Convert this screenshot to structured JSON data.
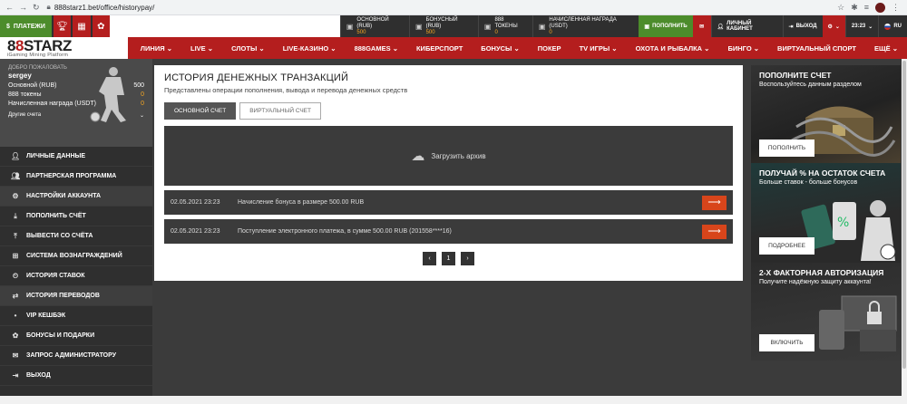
{
  "browser": {
    "url": "888starz1.bet/office/historypay/"
  },
  "topbar": {
    "pay_label": "ПЛАТЕЖИ",
    "accounts": [
      {
        "label": "ОСНОВНОЙ (RUB)",
        "value": "500"
      },
      {
        "label": "БОНУСНЫЙ (RUB)",
        "value": "500"
      },
      {
        "label": "888 ТОКЕНЫ",
        "value": "0"
      },
      {
        "label": "НАЧИСЛЕННАЯ НАГРАДА (USDT)",
        "value": "0"
      }
    ],
    "deposit_label": "ПОПОЛНИТЬ",
    "cabinet_label": "ЛИЧНЫЙ КАБИНЕТ",
    "logout_label": "ВЫХОД",
    "time": "23:23",
    "lang": "RU"
  },
  "logo": {
    "main_prefix": "8",
    "main_mid": "8",
    "main_rest": "STARZ",
    "tagline": "iGaming Mining Platform"
  },
  "menu": [
    "ЛИНИЯ",
    "LIVE",
    "СЛОТЫ",
    "LIVE-КАЗИНО",
    "888GAMES",
    "КИБЕРСПОРТ",
    "БОНУСЫ",
    "ПОКЕР",
    "TV ИГРЫ",
    "ОХОТА И РЫБАЛКА",
    "БИНГО",
    "ВИРТУАЛЬНЫЙ СПОРТ",
    "ЕЩЁ"
  ],
  "profile": {
    "welcome": "ДОБРО ПОЖАЛОВАТЬ",
    "username": "sergey",
    "rows": [
      {
        "label": "Основной (RUB)",
        "value": "500"
      },
      {
        "label": "888 токены",
        "value": "0"
      },
      {
        "label": "Начисленная награда (USDT)",
        "value": "0"
      }
    ],
    "other_accounts": "Другие счета"
  },
  "sidebar": [
    "ЛИЧНЫЕ ДАННЫЕ",
    "ПАРТНЕРСКАЯ ПРОГРАММА",
    "НАСТРОЙКИ АККАУНТА",
    "ПОПОЛНИТЬ СЧЁТ",
    "ВЫВЕСТИ СО СЧЁТА",
    "СИСТЕМА ВОЗНАГРАЖДЕНИЙ",
    "ИСТОРИЯ СТАВОК",
    "ИСТОРИЯ ПЕРЕВОДОВ",
    "VIP КЕШБЭК",
    "БОНУСЫ И ПОДАРКИ",
    "ЗАПРОС АДМИНИСТРАТОРУ",
    "ВЫХОД"
  ],
  "main": {
    "title": "ИСТОРИЯ ДЕНЕЖНЫХ ТРАНЗАКЦИЙ",
    "subtitle": "Представлены операции пополнения, вывода и перевода денежных средств",
    "tab_main": "ОСНОВНОЙ СЧЕТ",
    "tab_virtual": "ВИРТУАЛЬНЫЙ СЧЕТ",
    "archive": "Загрузить архив",
    "transactions": [
      {
        "date": "02.05.2021 23:23",
        "text": "Начисление бонуса в размере 500.00 RUB"
      },
      {
        "date": "02.05.2021 23:23",
        "text": "Поступление электронного платежа, в сумме 500.00 RUB (201558****16)"
      }
    ],
    "page": "1"
  },
  "promos": [
    {
      "title": "ПОПОЛНИТЕ СЧЕТ",
      "sub": "Воспользуйтесь данным разделом",
      "button": "ПОПОЛНИТЬ"
    },
    {
      "title": "ПОЛУЧАЙ % НА ОСТАТОК СЧЕТА",
      "sub": "Больше ставок - больше бонусов",
      "button": "ПОДРОБНЕЕ"
    },
    {
      "title": "2-Х ФАКТОРНАЯ АВТОРИЗАЦИЯ",
      "sub": "Получите надёжную защиту аккаунта!",
      "button": "ВКЛЮЧИТЬ"
    }
  ]
}
